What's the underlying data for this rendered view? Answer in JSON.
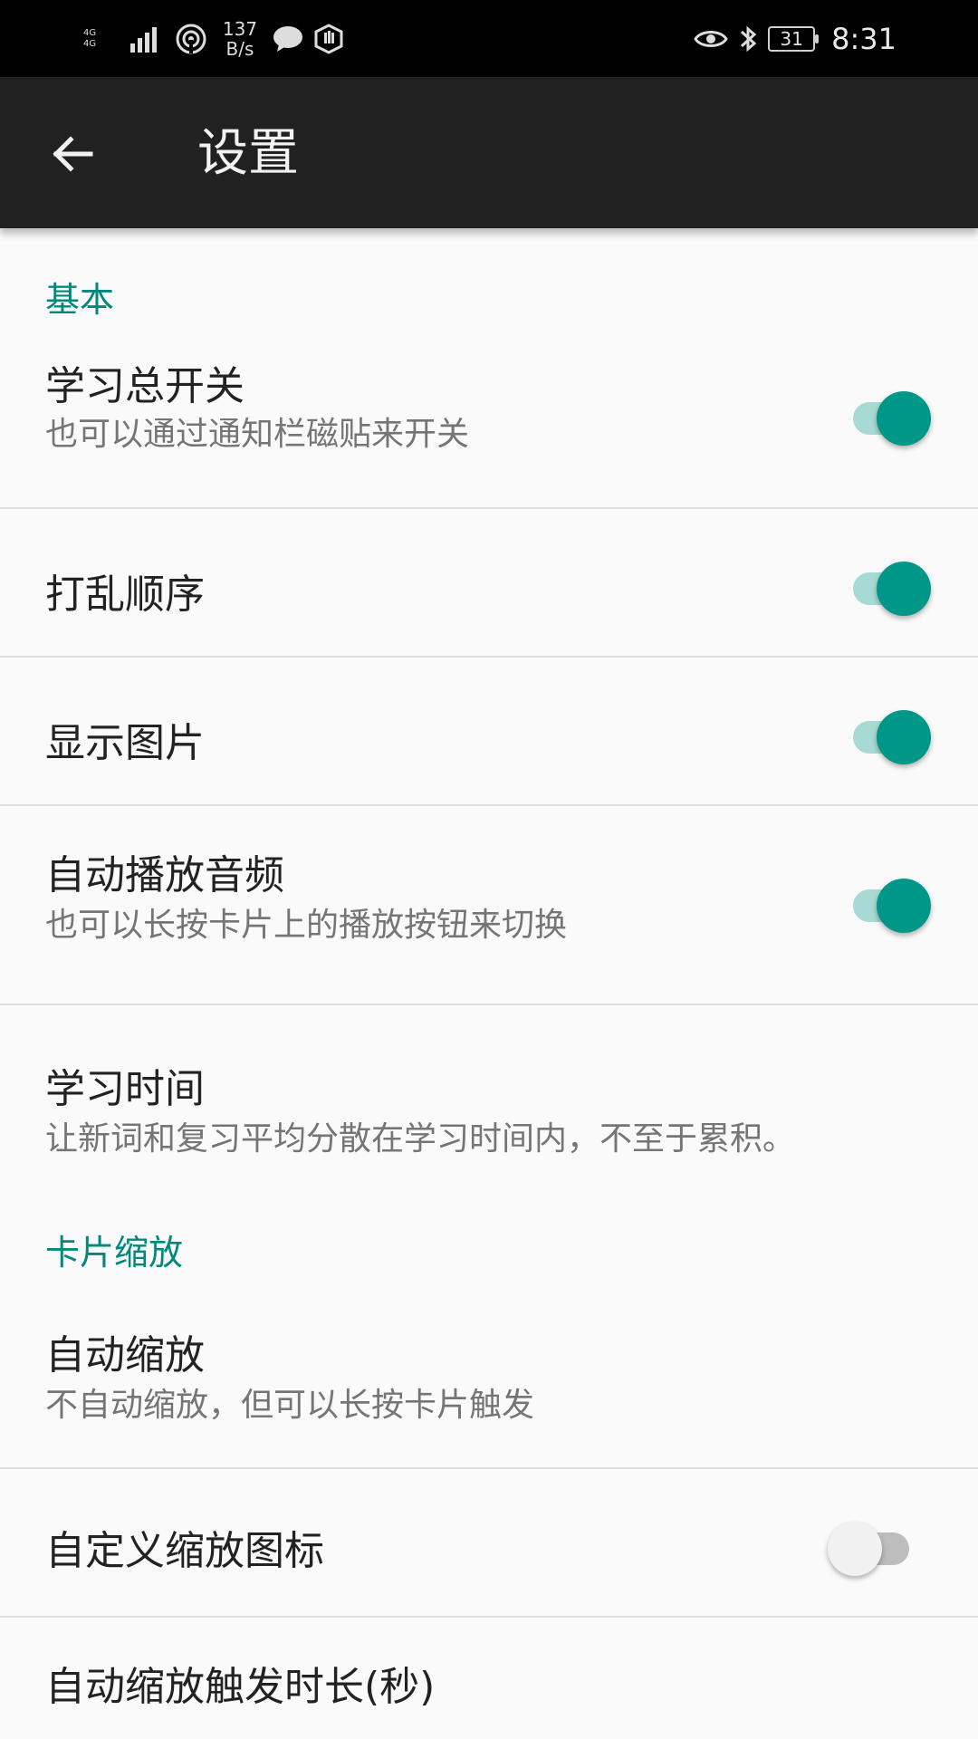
{
  "status_bar": {
    "network_left": "4G",
    "network_right": "4G",
    "speed_top": "137",
    "speed_bottom": "B/s",
    "battery": "31",
    "time": "8:31"
  },
  "app_bar": {
    "title": "设置"
  },
  "sections": [
    {
      "header": "基本",
      "items": [
        {
          "title": "学习总开关",
          "subtitle": "也可以通过通知栏磁贴来开关",
          "switch_on": true
        },
        {
          "title": "打乱顺序",
          "switch_on": true
        },
        {
          "title": "显示图片",
          "switch_on": true
        },
        {
          "title": "自动播放音频",
          "subtitle": "也可以长按卡片上的播放按钮来切换",
          "switch_on": true
        },
        {
          "title": "学习时间",
          "subtitle": "让新词和复习平均分散在学习时间内，不至于累积。"
        }
      ]
    },
    {
      "header": "卡片缩放",
      "items": [
        {
          "title": "自动缩放",
          "subtitle": "不自动缩放，但可以长按卡片触发"
        },
        {
          "title": "自定义缩放图标",
          "switch_on": false
        },
        {
          "title": "自动缩放触发时长(秒)"
        }
      ]
    }
  ],
  "colors": {
    "accent": "#00897b",
    "switch_on_thumb": "#009688",
    "switch_on_track": "#a7dad4",
    "app_bar": "#212121"
  },
  "icons": {
    "back": "arrow-left-icon",
    "signal": "signal-icon",
    "hotspot": "hotspot-icon",
    "message": "chat-bubble-icon",
    "vpn": "shield-hand-icon",
    "eye": "eye-icon",
    "bluetooth": "bluetooth-icon",
    "battery": "battery-icon"
  }
}
